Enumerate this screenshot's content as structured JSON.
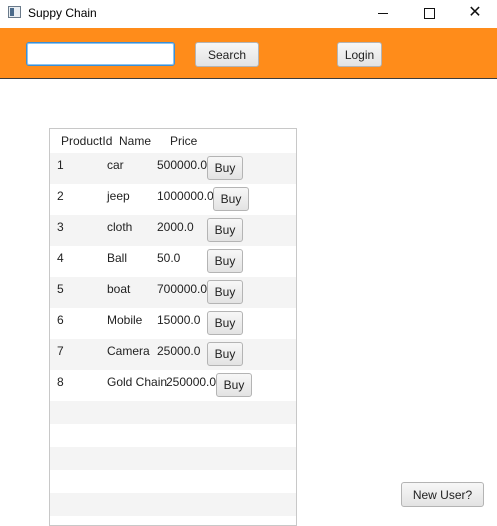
{
  "window": {
    "title": "Suppy Chain",
    "controls": {
      "minimize": "minimize-icon",
      "maximize": "maximize-icon",
      "close": "✕"
    }
  },
  "toolbar": {
    "search_value": "",
    "search_label": "Search",
    "login_label": "Login",
    "background": "#ff8c1a"
  },
  "table": {
    "columns": [
      "ProductId",
      "Name",
      "Price"
    ],
    "rows": [
      {
        "id": "1",
        "name": "car",
        "price": "500000.0",
        "action": "Buy"
      },
      {
        "id": "2",
        "name": "jeep",
        "price": "1000000.0",
        "action": "Buy"
      },
      {
        "id": "3",
        "name": "cloth",
        "price": "2000.0",
        "action": "Buy"
      },
      {
        "id": "4",
        "name": "Ball",
        "price": "50.0",
        "action": "Buy"
      },
      {
        "id": "5",
        "name": "boat",
        "price": "700000.0",
        "action": "Buy"
      },
      {
        "id": "6",
        "name": "Mobile",
        "price": "15000.0",
        "action": "Buy"
      },
      {
        "id": "7",
        "name": "Camera",
        "price": "25000.0",
        "action": "Buy"
      },
      {
        "id": "8",
        "name": "Gold Chain",
        "price": "250000.0",
        "action": "Buy"
      }
    ]
  },
  "footer": {
    "new_user_label": "New User?"
  }
}
